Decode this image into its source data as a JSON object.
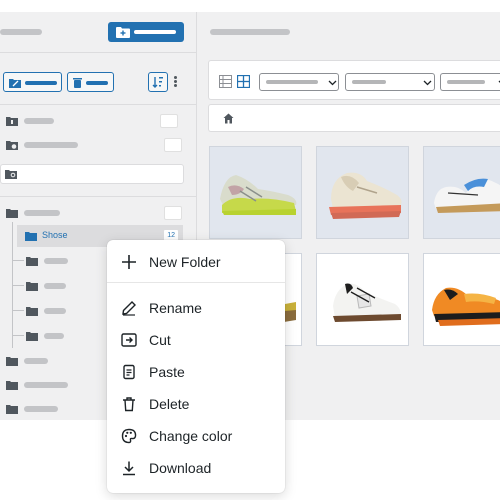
{
  "sidebar": {
    "search": {
      "placeholder": "",
      "value": ""
    },
    "selected_folder": {
      "label": "Shose",
      "count": "12"
    }
  },
  "context_menu": {
    "items": [
      {
        "label": "New Folder",
        "icon": "plus-icon"
      },
      {
        "label": "Rename",
        "icon": "pencil-icon"
      },
      {
        "label": "Cut",
        "icon": "cut-icon"
      },
      {
        "label": "Paste",
        "icon": "paste-icon"
      },
      {
        "label": "Delete",
        "icon": "trash-icon"
      },
      {
        "label": "Change color",
        "icon": "palette-icon"
      },
      {
        "label": "Download",
        "icon": "download-icon"
      }
    ]
  },
  "colors": {
    "accent": "#2271b1",
    "sidebar_bg": "#f0f0f1",
    "tile_bg": "#e1e6ee"
  },
  "gallery": {
    "tiles": [
      {
        "icon": "sneaker-neon-yellow"
      },
      {
        "icon": "sneaker-cream-pink"
      },
      {
        "icon": "sneaker-white-blue"
      },
      {
        "icon": "sneaker-partial"
      },
      {
        "icon": "sneaker-white-black"
      },
      {
        "icon": "sneaker-orange-black"
      }
    ]
  }
}
